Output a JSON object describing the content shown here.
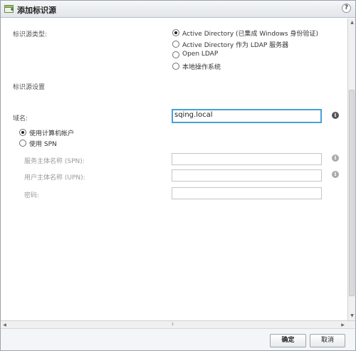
{
  "window": {
    "title": "添加标识源",
    "help_label": "?"
  },
  "form": {
    "identity_source_type_label": "标识源类型:",
    "identity_source_types": [
      {
        "label": "Active Directory (已集成 Windows 身份验证)",
        "checked": true
      },
      {
        "label": "Active Directory 作为 LDAP 服务器",
        "checked": false
      },
      {
        "label": "Open LDAP",
        "checked": false
      },
      {
        "label": "本地操作系统",
        "checked": false
      }
    ],
    "settings_label": "标识源设置",
    "domain_label": "域名:",
    "domain_value": "sqing.local",
    "auth_options": [
      {
        "label": "使用计算机帐户",
        "checked": true
      },
      {
        "label": "使用 SPN",
        "checked": false
      }
    ],
    "spn_label": "服务主体名称 (SPN):",
    "spn_value": "",
    "upn_label": "用户主体名称 (UPN):",
    "upn_value": "",
    "password_label": "密码:",
    "password_value": ""
  },
  "icons": {
    "info_glyph": "i",
    "up_arrow": "▲",
    "down_arrow": "▼",
    "left_arrow": "◀",
    "right_arrow": "▶",
    "grip": "⁞⁞"
  },
  "footer": {
    "ok_label": "确定",
    "cancel_label": "取消"
  }
}
